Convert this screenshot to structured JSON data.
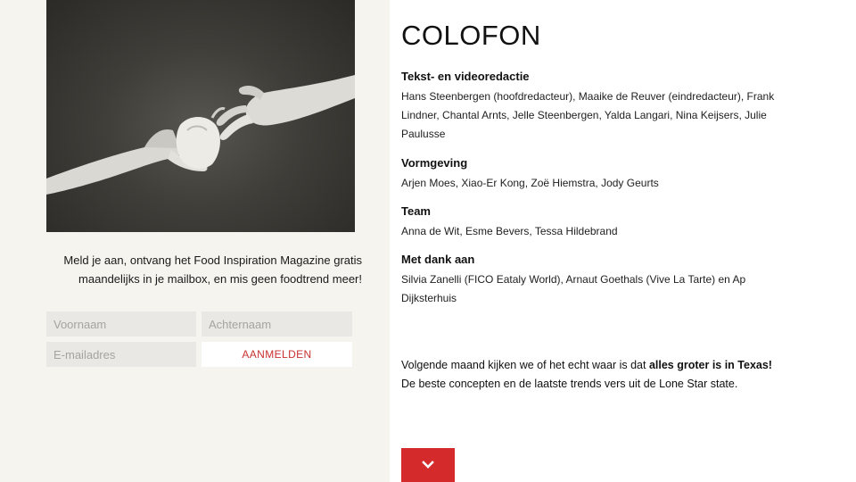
{
  "signup": {
    "text": "Meld je aan, ontvang het Food Inspiration Magazine gratis maandelijks in je mailbox, en mis geen foodtrend meer!",
    "first_name_placeholder": "Voornaam",
    "last_name_placeholder": "Achternaam",
    "email_placeholder": "E-mailadres",
    "button_label": "AANMELDEN"
  },
  "colofon": {
    "title": "COLOFON",
    "sections": [
      {
        "heading": "Tekst- en videoredactie",
        "body": "Hans Steenbergen (hoofdredacteur), Maaike de Reuver (eindredacteur), Frank Lindner, Chantal Arnts, Jelle Steenbergen, Yalda Langari, Nina Keijsers, Julie Paulusse"
      },
      {
        "heading": "Vormgeving",
        "body": "Arjen Moes, Xiao-Er Kong, Zoë Hiemstra, Jody Geurts"
      },
      {
        "heading": "Team",
        "body": "Anna de Wit, Esme Bevers, Tessa Hildebrand"
      },
      {
        "heading": "Met dank aan",
        "body": "Silvia Zanelli (FICO Eataly World), Arnaut Goethals (Vive La Tarte) en Ap Dijksterhuis"
      }
    ]
  },
  "teaser": {
    "line1_prefix": "Volgende maand kijken we of het echt waar is dat ",
    "line1_bold": "alles groter is in Texas!",
    "line2": "De beste concepten en de laatste trends vers uit de Lone Star state."
  },
  "icons": {
    "down_button": "chevron-down-icon"
  },
  "colors": {
    "accent": "#d42a2c",
    "left_background": "#f5f4ef",
    "field_background": "#e9e8e4"
  }
}
